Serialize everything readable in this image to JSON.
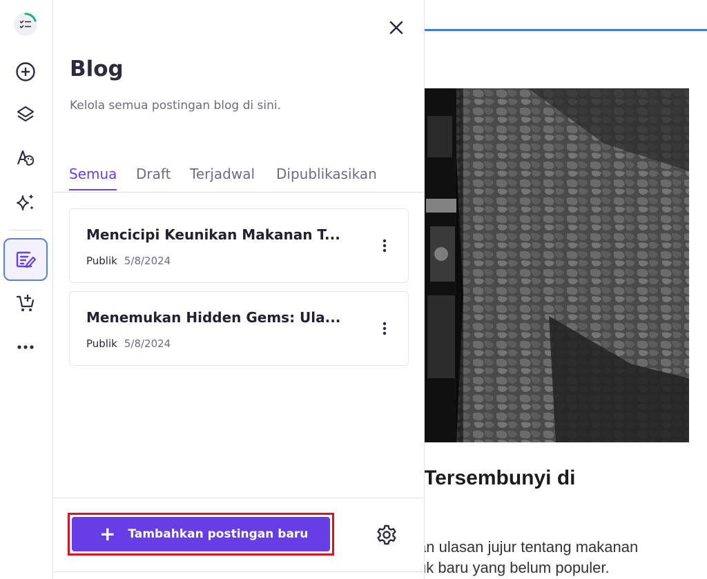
{
  "panel": {
    "title": "Blog",
    "subtitle": "Kelola semua postingan blog di sini.",
    "tabs": [
      {
        "label": "Semua",
        "active": true
      },
      {
        "label": "Draft",
        "active": false
      },
      {
        "label": "Terjadwal",
        "active": false
      },
      {
        "label": "Dipublikasikan",
        "active": false
      }
    ],
    "posts": [
      {
        "title": "Mencicipi Keunikan Makanan T...",
        "status": "Publik",
        "date": "5/8/2024"
      },
      {
        "title": "Menemukan Hidden Gems: Ula...",
        "status": "Publik",
        "date": "5/8/2024"
      }
    ],
    "add_button_label": "Tambahkan postingan baru"
  },
  "preview": {
    "heading": "Tersembunyi di",
    "text_line1": "an ulasan jujur tentang makanan",
    "text_line2": "uk baru yang belum populer."
  },
  "rail": {
    "items": [
      "checklist-logo",
      "add-icon",
      "layers-icon",
      "design-icon",
      "ai-sparkle-icon",
      "blog-edit-icon",
      "cart-add-icon",
      "more-icon"
    ],
    "active_item": "blog-edit-icon"
  },
  "colors": {
    "accent": "#673de6",
    "highlight_border": "#e0101e",
    "preview_bar": "#3f7be0"
  }
}
